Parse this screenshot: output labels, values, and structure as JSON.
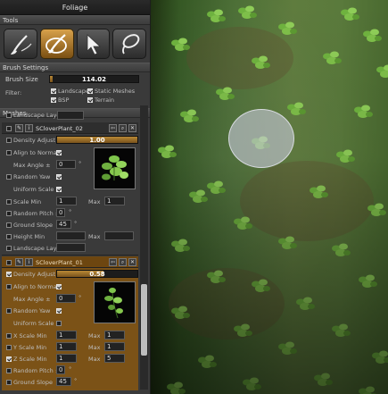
{
  "window": {
    "title": "Foliage"
  },
  "tools": {
    "header": "Tools",
    "items": [
      {
        "name": "paint",
        "icon": "paintbrush-icon"
      },
      {
        "name": "reapply",
        "icon": "brush-plant-icon",
        "active": true
      },
      {
        "name": "select",
        "icon": "arrow-cursor-icon"
      },
      {
        "name": "lasso",
        "icon": "lasso-icon"
      }
    ]
  },
  "brush": {
    "header": "Brush Settings",
    "size_label": "Brush Size",
    "size_value": "114.02",
    "size_fraction": 0.03,
    "filter_label": "Filter:",
    "filters": [
      {
        "label": "Landscape",
        "checked": true
      },
      {
        "label": "Static Meshes",
        "checked": true
      },
      {
        "label": "BSP",
        "checked": true
      },
      {
        "label": "Terrain",
        "checked": true
      }
    ]
  },
  "meshes": {
    "header": "Meshes",
    "landscape_layer_label": "Landscape Layer",
    "items": [
      {
        "name": "SCloverPlant_02",
        "density_label": "Density Adjust",
        "density_value": "1.00",
        "density_fraction": 1.0,
        "align_label": "Align to Normal",
        "max_angle_label": "Max Angle ±",
        "max_angle_value": "0",
        "random_yaw_label": "Random Yaw",
        "uniform_scale_label": "Uniform Scale",
        "scale_min_label": "Scale Min",
        "scale_min_value": "1",
        "max_label": "Max",
        "scale_max_value": "1",
        "random_pitch_label": "Random Pitch ±",
        "random_pitch_value": "0",
        "ground_slope_label": "Ground Slope",
        "ground_slope_value": "45",
        "height_min_label": "Height Min",
        "height_max_label": "Max",
        "landscape_layer_label": "Landscape Layer"
      },
      {
        "name": "SCloverPlant_01",
        "density_label": "Density Adjust",
        "density_value": "0.58",
        "density_fraction": 0.58,
        "align_label": "Align to Normal",
        "max_angle_label": "Max Angle ±",
        "max_angle_value": "0",
        "random_yaw_label": "Random Yaw",
        "uniform_scale_label": "Uniform Scale",
        "x_scale_label": "X Scale Min",
        "x_min_value": "1",
        "x_max_value": "1",
        "y_scale_label": "Y Scale Min",
        "y_min_value": "1",
        "y_max_value": "1",
        "z_scale_label": "Z Scale Min",
        "z_min_value": "1",
        "z_max_value": "5",
        "max_label": "Max",
        "random_pitch_label": "Random Pitch ±",
        "random_pitch_value": "0",
        "ground_slope_label": "Ground Slope",
        "ground_slope_value": "45"
      }
    ]
  },
  "icons": {
    "degree": "°",
    "search": "🔍",
    "close": "✕",
    "brush": "✎"
  }
}
